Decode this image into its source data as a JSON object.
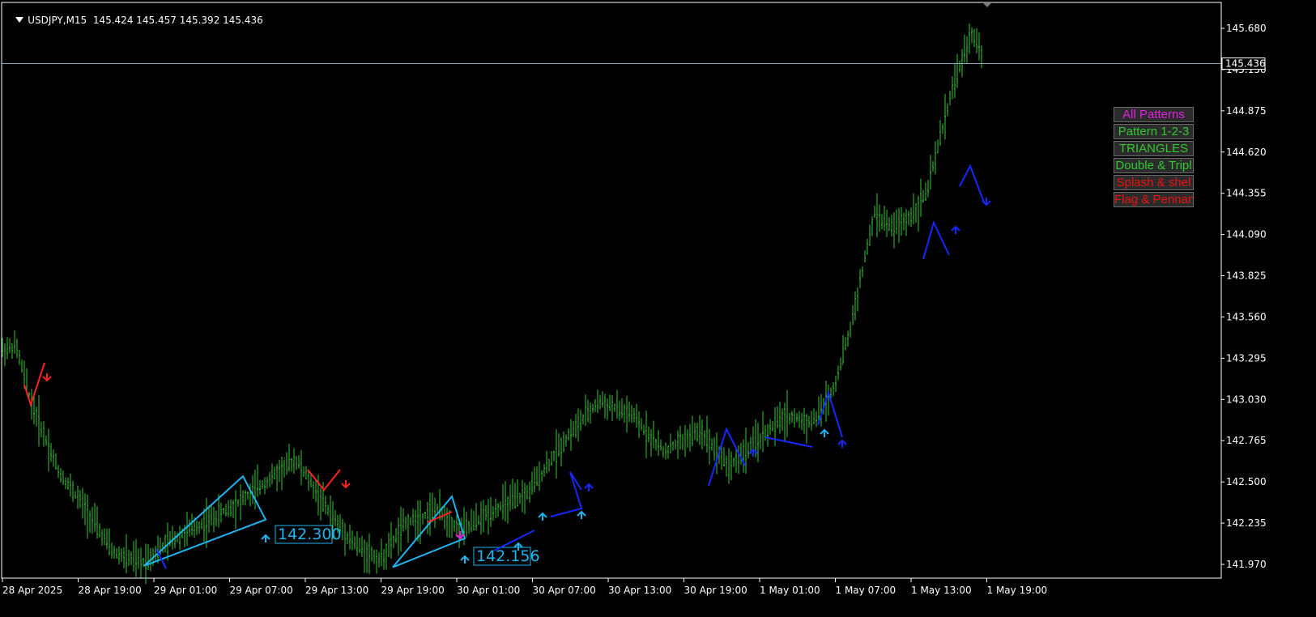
{
  "header": {
    "symbol": "USDJPY,M15",
    "ohlc": "145.424 145.457 145.392 145.436"
  },
  "price_axis": {
    "labels": [
      "145.680",
      "145.150",
      "144.875",
      "144.620",
      "144.355",
      "144.090",
      "143.825",
      "143.560",
      "143.295",
      "143.030",
      "142.765",
      "142.500",
      "142.235",
      "141.970"
    ],
    "current_price": "145.436"
  },
  "time_axis": {
    "labels": [
      "28 Apr 2025",
      "28 Apr 19:00",
      "29 Apr 01:00",
      "29 Apr 07:00",
      "29 Apr 13:00",
      "29 Apr 19:00",
      "30 Apr 01:00",
      "30 Apr 07:00",
      "30 Apr 13:00",
      "30 Apr 19:00",
      "1 May 01:00",
      "1 May 07:00",
      "1 May 13:00",
      "1 May 19:00"
    ]
  },
  "annotations": {
    "label1": "142.300",
    "label2": "142.156"
  },
  "panel": {
    "buttons": [
      {
        "label": "All Patterns",
        "color": "pink"
      },
      {
        "label": "Pattern 1-2-3",
        "color": "green"
      },
      {
        "label": "TRIANGLES",
        "color": "green"
      },
      {
        "label": "Double & Tripl",
        "color": "green"
      },
      {
        "label": "Splash & shel",
        "color": "red"
      },
      {
        "label": "Flag & Pennan",
        "color": "red"
      }
    ]
  },
  "colors": {
    "background": "#000000",
    "bar": "#33c833",
    "triangle": "#1eb4f0",
    "pattern_line": "#1428ff",
    "red_line": "#ff2222",
    "axis": "#ffffff",
    "price_line": "#8aa6b8"
  },
  "chart_data": {
    "type": "bar",
    "title": "",
    "xlabel": "",
    "ylabel": "",
    "ylim": [
      141.9,
      145.75
    ],
    "x": [
      "28 Apr 2025",
      "28 Apr 19:00",
      "29 Apr 01:00",
      "29 Apr 07:00",
      "29 Apr 13:00",
      "29 Apr 19:00",
      "30 Apr 01:00",
      "30 Apr 07:00",
      "30 Apr 13:00",
      "30 Apr 19:00",
      "1 May 01:00",
      "1 May 07:00",
      "1 May 13:00",
      "1 May 19:00"
    ],
    "series": [
      {
        "values": [
          143.45,
          143.48,
          143.1,
          142.62,
          142.4,
          142.05,
          141.98,
          142.15,
          142.28,
          142.42,
          142.7,
          142.3,
          142.1,
          142.0,
          142.25,
          142.35,
          142.2,
          142.35,
          142.45,
          142.85,
          143.1,
          143.0,
          142.75,
          142.9,
          142.65,
          142.85,
          143.0,
          142.95,
          143.0,
          143.2,
          143.6,
          144.0,
          144.4,
          144.3,
          144.35,
          144.55,
          145.25,
          145.65,
          145.44
        ]
      }
    ],
    "patterns": {
      "triangles": [
        {
          "points": [
            141.96,
            142.58,
            142.28
          ],
          "label": "142.300"
        },
        {
          "points": [
            141.95,
            142.44,
            142.15
          ],
          "label": "142.156"
        }
      ]
    },
    "grid": false,
    "legend": "none"
  }
}
